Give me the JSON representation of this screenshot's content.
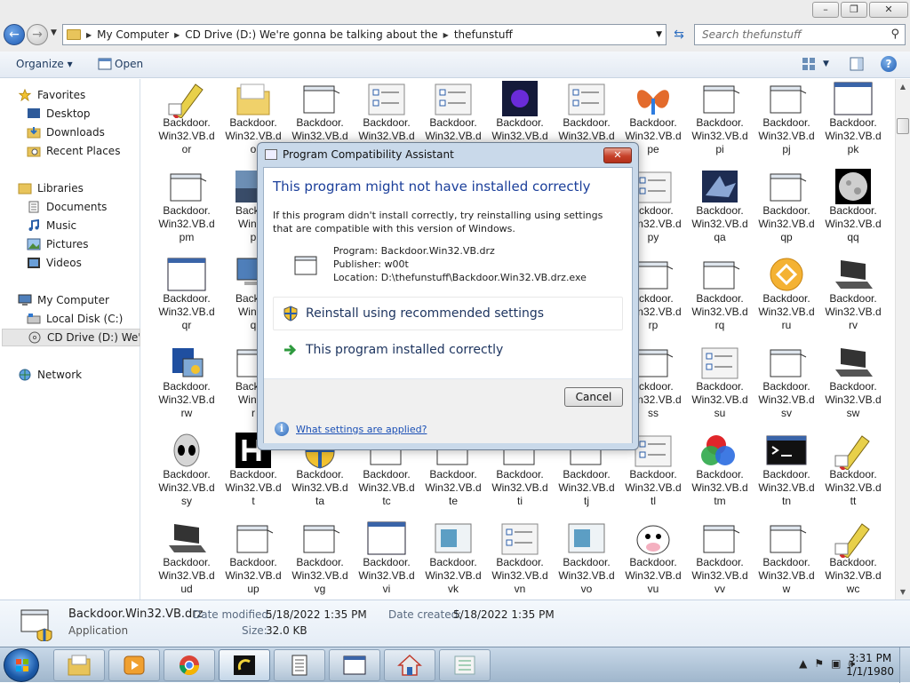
{
  "window": {
    "caption_buttons": [
      "–",
      "❐",
      "✕"
    ]
  },
  "address": {
    "back": "←",
    "forward": "→",
    "crumbs": [
      "My Computer",
      "CD Drive (D:) We're gonna be talking about the",
      "thefunstuff"
    ],
    "search_placeholder": "Search thefunstuff"
  },
  "toolbar": {
    "organize_label": "Organize",
    "organize_arrow": "▾",
    "open_label": "Open",
    "help": "?"
  },
  "nav": {
    "items": [
      {
        "label": "Favorites",
        "icon": "star-icon"
      },
      {
        "label": "Desktop",
        "icon": "desktop-icon"
      },
      {
        "label": "Downloads",
        "icon": "downloads-icon"
      },
      {
        "label": "Recent Places",
        "icon": "recent-places-icon"
      },
      {
        "label": "Libraries",
        "icon": "libraries-icon"
      },
      {
        "label": "Documents",
        "icon": "documents-icon"
      },
      {
        "label": "Music",
        "icon": "music-icon"
      },
      {
        "label": "Pictures",
        "icon": "pictures-icon"
      },
      {
        "label": "Videos",
        "icon": "videos-icon"
      },
      {
        "label": "My Computer",
        "icon": "computer-icon"
      },
      {
        "label": "Local Disk (C:)",
        "icon": "local-disk-icon"
      },
      {
        "label": "CD Drive (D:) We're g",
        "icon": "cd-drive-icon"
      },
      {
        "label": "Network",
        "icon": "network-icon"
      }
    ]
  },
  "files": {
    "rows": [
      [
        [
          "Backdoor.",
          "Win32.VB.d",
          "or"
        ],
        [
          "Backdoor.",
          "Win32.VB.d",
          "o"
        ],
        [
          "Backdoor.",
          "Win32.VB.d",
          ""
        ],
        [
          "Backdoor.",
          "Win32.VB.d",
          ""
        ],
        [
          "Backdoor.",
          "Win32.VB.d",
          ""
        ],
        [
          "Backdoor.",
          "Win32.VB.d",
          ""
        ],
        [
          "Backdoor.",
          "Win32.VB.d",
          ""
        ],
        [
          "Backdoor.",
          "Win32.VB.d",
          "pe"
        ],
        [
          "Backdoor.",
          "Win32.VB.d",
          "pi"
        ],
        [
          "Backdoor.",
          "Win32.VB.d",
          "pj"
        ],
        [
          "Backdoor.",
          "Win32.VB.d",
          "pk"
        ]
      ],
      [
        [
          "Backdoor.",
          "Win32.VB.d",
          "pm"
        ],
        [
          "Backdo",
          "Win32",
          "p"
        ],
        null,
        null,
        null,
        null,
        null,
        [
          "ackdoor.",
          "Win32.VB.d",
          "py"
        ],
        [
          "Backdoor.",
          "Win32.VB.d",
          "qa"
        ],
        [
          "Backdoor.",
          "Win32.VB.d",
          "qp"
        ],
        [
          "Backdoor.",
          "Win32.VB.d",
          "qq"
        ]
      ],
      [
        [
          "Backdoor.",
          "Win32.VB.d",
          "qr"
        ],
        [
          "Backdo",
          "Win32",
          "q"
        ],
        null,
        null,
        null,
        null,
        null,
        [
          "ackdoor.",
          "Win32.VB.d",
          "rp"
        ],
        [
          "Backdoor.",
          "Win32.VB.d",
          "rq"
        ],
        [
          "Backdoor.",
          "Win32.VB.d",
          "ru"
        ],
        [
          "Backdoor.",
          "Win32.VB.d",
          "rv"
        ]
      ],
      [
        [
          "Backdoor.",
          "Win32.VB.d",
          "rw"
        ],
        [
          "Backdo",
          "Win32",
          "r"
        ],
        null,
        null,
        null,
        null,
        null,
        [
          "ackdoor.",
          "Win32.VB.d",
          "ss"
        ],
        [
          "Backdoor.",
          "Win32.VB.d",
          "su"
        ],
        [
          "Backdoor.",
          "Win32.VB.d",
          "sv"
        ],
        [
          "Backdoor.",
          "Win32.VB.d",
          "sw"
        ]
      ],
      [
        [
          "Backdoor.",
          "Win32.VB.d",
          "sy"
        ],
        [
          "Backdoor.",
          "Win32.VB.d",
          "t"
        ],
        [
          "Backdoor.",
          "Win32.VB.d",
          "ta"
        ],
        [
          "Backdoor.",
          "Win32.VB.d",
          "tc"
        ],
        [
          "Backdoor.",
          "Win32.VB.d",
          "te"
        ],
        [
          "Backdoor.",
          "Win32.VB.d",
          "ti"
        ],
        [
          "Backdoor.",
          "Win32.VB.d",
          "tj"
        ],
        [
          "Backdoor.",
          "Win32.VB.d",
          "tl"
        ],
        [
          "Backdoor.",
          "Win32.VB.d",
          "tm"
        ],
        [
          "Backdoor.",
          "Win32.VB.d",
          "tn"
        ],
        [
          "Backdoor.",
          "Win32.VB.d",
          "tt"
        ]
      ],
      [
        [
          "Backdoor.",
          "Win32.VB.d",
          "ud"
        ],
        [
          "Backdoor.",
          "Win32.VB.d",
          "up"
        ],
        [
          "Backdoor.",
          "Win32.VB.d",
          "vg"
        ],
        [
          "Backdoor.",
          "Win32.VB.d",
          "vi"
        ],
        [
          "Backdoor.",
          "Win32.VB.d",
          "vk"
        ],
        [
          "Backdoor.",
          "Win32.VB.d",
          "vn"
        ],
        [
          "Backdoor.",
          "Win32.VB.d",
          "vo"
        ],
        [
          "Backdoor.",
          "Win32.VB.d",
          "vu"
        ],
        [
          "Backdoor.",
          "Win32.VB.d",
          "vv"
        ],
        [
          "Backdoor.",
          "Win32.VB.d",
          "w"
        ],
        [
          "Backdoor.",
          "Win32.VB.d",
          "wc"
        ]
      ]
    ],
    "icon_kinds": [
      [
        "pen",
        "folder",
        "window",
        "checklist",
        "checklist",
        "photo-dark",
        "checklist",
        "butterfly",
        "window",
        "window",
        "blank-window"
      ],
      [
        "window",
        "photo",
        "",
        "",
        "",
        "",
        "",
        "checklist",
        "shark",
        "window",
        "moon"
      ],
      [
        "blank-window",
        "computer",
        "",
        "",
        "",
        "",
        "",
        "window",
        "window",
        "orb",
        "laptop"
      ],
      [
        "setup",
        "window",
        "",
        "",
        "",
        "",
        "",
        "window",
        "checklist",
        "window",
        "laptop"
      ],
      [
        "alien",
        "h-icon",
        "shield",
        "",
        "",
        "",
        "",
        "checklist",
        "colors",
        "cmd",
        "pen"
      ],
      [
        "laptop",
        "window",
        "window",
        "blank-window",
        "screen",
        "checklist",
        "screen",
        "cow",
        "window",
        "window",
        "pen"
      ]
    ]
  },
  "details": {
    "name": "Backdoor.Win32.VB.drz",
    "type": "Application",
    "modified_label": "Date modified:",
    "modified_value": "5/18/2022 1:35 PM",
    "created_label": "Date created:",
    "created_value": "5/18/2022 1:35 PM",
    "size_label": "Size:",
    "size_value": "32.0 KB"
  },
  "dialog": {
    "title": "Program Compatibility Assistant",
    "close": "✕",
    "heading": "This program might not have installed correctly",
    "body": "If this program didn't install correctly, try reinstalling using settings that are compatible with this version of Windows.",
    "program": "Program: Backdoor.Win32.VB.drz",
    "publisher": "Publisher: w00t",
    "location": "Location: D:\\thefunstuff\\Backdoor.Win32.VB.drz.exe",
    "option_reinstall": "Reinstall using recommended settings",
    "option_correct": "This program installed correctly",
    "cancel": "Cancel",
    "help_link": "What settings are applied?",
    "info_glyph": "i"
  },
  "taskbar": {
    "tray_arrow": "▲",
    "time": "3:31 PM",
    "date": "1/1/1980"
  },
  "colors": {
    "link": "#1a4fb5",
    "heading": "#1b3f9a",
    "taskbar": "#9fb6cc"
  }
}
